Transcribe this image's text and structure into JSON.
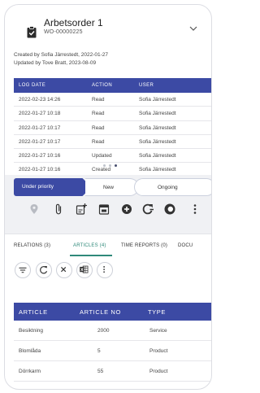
{
  "order": {
    "title": "Arbetsorder 1",
    "number": "WO-00000225",
    "created": "Created by Sofia Järrestedt, 2022-01-27",
    "updated": "Updated by Tove Bratt, 2023-08-09"
  },
  "log": {
    "headers": [
      "LOG DATE",
      "ACTION",
      "USER"
    ],
    "rows": [
      {
        "date": "2022-02-23 14:26",
        "action": "Read",
        "user": "Sofia Järrestedt"
      },
      {
        "date": "2022-01-27 10:18",
        "action": "Read",
        "user": "Sofia Järrestedt"
      },
      {
        "date": "2022-01-27 10:17",
        "action": "Read",
        "user": "Sofia Järrestedt"
      },
      {
        "date": "2022-01-27 10:17",
        "action": "Read",
        "user": "Sofia Järrestedt"
      },
      {
        "date": "2022-01-27 10:16",
        "action": "Updated",
        "user": "Sofia Järrestedt"
      },
      {
        "date": "2022-01-27 10:16",
        "action": "Created",
        "user": "Sofia Järrestedt"
      }
    ]
  },
  "status": {
    "steps": [
      "Under priority",
      "New",
      "Ongoing"
    ],
    "active_index": 0
  },
  "tabs": [
    "RELATIONS (3)",
    "ARTICLES (4)",
    "TIME REPORTS (0)",
    "DOCU"
  ],
  "articles": {
    "headers": [
      "ARTICLE",
      "ARTICLE NO",
      "TYPE"
    ],
    "rows": [
      {
        "article": "Besiktning",
        "no": "2000",
        "type": "Service"
      },
      {
        "article": "Blomlåda",
        "no": "5",
        "type": "Product"
      },
      {
        "article": "Dörrkarm",
        "no": "55",
        "type": "Product"
      }
    ]
  },
  "colors": {
    "primary": "#3c4aa4",
    "accent": "#2f8a7a",
    "band": "#f0f1f4"
  },
  "icons": [
    "document-icon",
    "chevron-down-icon",
    "location-pin-icon",
    "paperclip-icon",
    "add-note-icon",
    "calendar-icon",
    "add-circle-icon",
    "refresh-add-icon",
    "tag-icon",
    "more-vert-icon",
    "filter-icon",
    "refresh-icon",
    "close-icon",
    "excel-icon"
  ]
}
